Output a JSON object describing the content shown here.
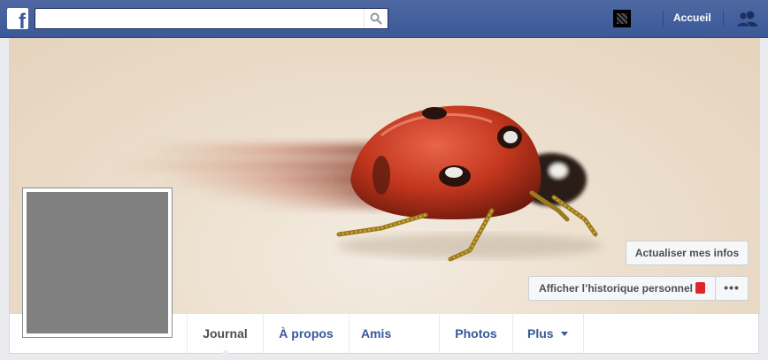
{
  "topbar": {
    "logo_letter": "f",
    "search": {
      "value": "",
      "placeholder": ""
    },
    "home_label": "Accueil"
  },
  "profile": {
    "actions": {
      "update_info": "Actualiser mes infos",
      "view_activity_log": "Afficher l’historique personnel",
      "more": "•••"
    },
    "tabs": [
      {
        "label": "Journal",
        "active": true
      },
      {
        "label": "À propos",
        "active": false
      },
      {
        "label": "Amis",
        "active": false
      },
      {
        "label": "Photos",
        "active": false
      },
      {
        "label": "Plus",
        "active": false
      }
    ]
  },
  "colors": {
    "brand_blue": "#3b5998",
    "link_blue": "#365899",
    "notification_red": "#e0242b",
    "profile_placeholder": "#808080"
  },
  "icons": [
    "facebook-logo-icon",
    "search-icon",
    "friend-requests-icon",
    "caret-down-icon"
  ]
}
